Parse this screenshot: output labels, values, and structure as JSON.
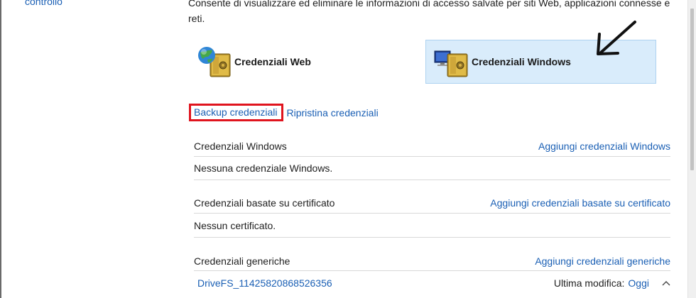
{
  "sidebar": {
    "link_label": "controllo"
  },
  "description": "Consente di visualizzare ed eliminare le informazioni di accesso salvate per siti Web, applicazioni connesse e reti.",
  "tiles": {
    "web": {
      "label": "Credenziali Web",
      "icon": "globe-safe-icon",
      "selected": false
    },
    "windows": {
      "label": "Credenziali Windows",
      "icon": "computer-safe-icon",
      "selected": true
    }
  },
  "actions": {
    "backup_label": "Backup credenziali",
    "restore_label": "Ripristina credenziali"
  },
  "sections": [
    {
      "title": "Credenziali Windows",
      "add_label": "Aggiungi credenziali Windows",
      "empty_text": "Nessuna credenziale Windows."
    },
    {
      "title": "Credenziali basate su certificato",
      "add_label": "Aggiungi credenziali basate su certificato",
      "empty_text": "Nessun certificato."
    },
    {
      "title": "Credenziali generiche",
      "add_label": "Aggiungi credenziali generiche"
    }
  ],
  "generic_entries": [
    {
      "name": "DriveFS_11425820868526356",
      "modified_label": "Ultima modifica:",
      "modified_value": "Oggi",
      "expand_icon": "chevron-up-icon"
    }
  ],
  "colors": {
    "link": "#1a5fb4",
    "selected_tile_bg": "#d9ecfb",
    "highlight_box": "#e0141e"
  }
}
